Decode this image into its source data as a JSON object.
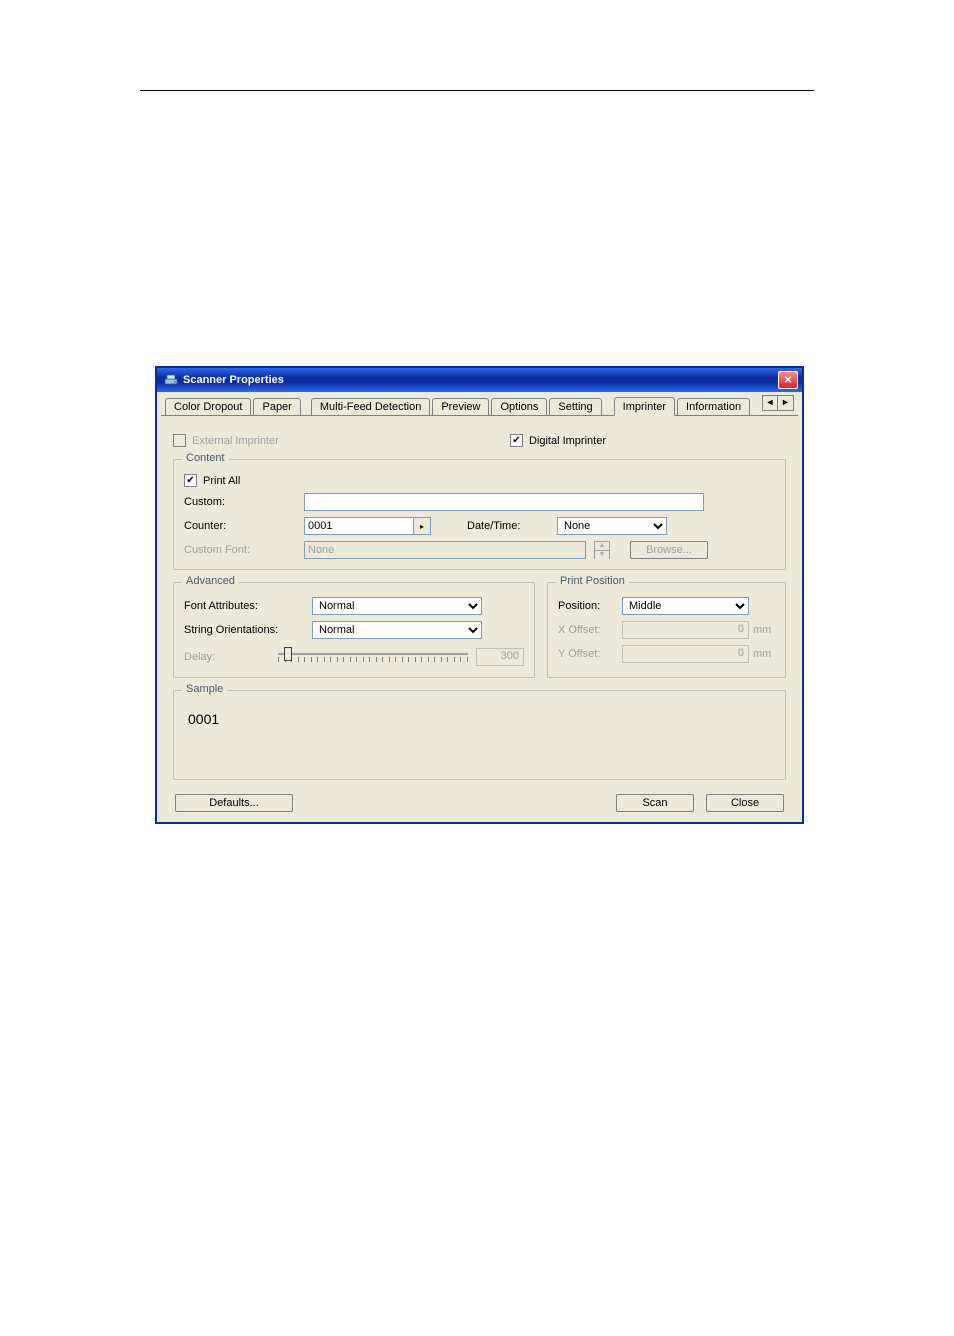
{
  "window": {
    "title": "Scanner Properties"
  },
  "tabs": {
    "items": [
      {
        "label": "Color Dropout"
      },
      {
        "label": "Paper"
      },
      {
        "label": "Multi-Feed Detection"
      },
      {
        "label": "Preview"
      },
      {
        "label": "Options"
      },
      {
        "label": "Setting"
      },
      {
        "label": "Imprinter"
      },
      {
        "label": "Information"
      }
    ],
    "active_index": 6
  },
  "imprinter": {
    "external_label": "External Imprinter",
    "external_checked": false,
    "digital_label": "Digital Imprinter",
    "digital_checked": true
  },
  "content": {
    "legend": "Content",
    "print_all_label": "Print All",
    "print_all_checked": true,
    "custom_label": "Custom:",
    "custom_value": "",
    "counter_label": "Counter:",
    "counter_value": "0001",
    "datetime_label": "Date/Time:",
    "datetime_value": "None",
    "custom_font_label": "Custom Font:",
    "custom_font_value": "None",
    "browse_label": "Browse..."
  },
  "advanced": {
    "legend": "Advanced",
    "font_attr_label": "Font Attributes:",
    "font_attr_value": "Normal",
    "orient_label": "String Orientations:",
    "orient_value": "Normal",
    "delay_label": "Delay:",
    "delay_value": "300"
  },
  "print_position": {
    "legend": "Print Position",
    "position_label": "Position:",
    "position_value": "Middle",
    "x_label": "X Offset:",
    "x_value": "0",
    "y_label": "Y Offset:",
    "y_value": "0",
    "unit": "mm"
  },
  "sample": {
    "legend": "Sample",
    "value": "0001"
  },
  "buttons": {
    "defaults": "Defaults...",
    "scan": "Scan",
    "close": "Close"
  }
}
